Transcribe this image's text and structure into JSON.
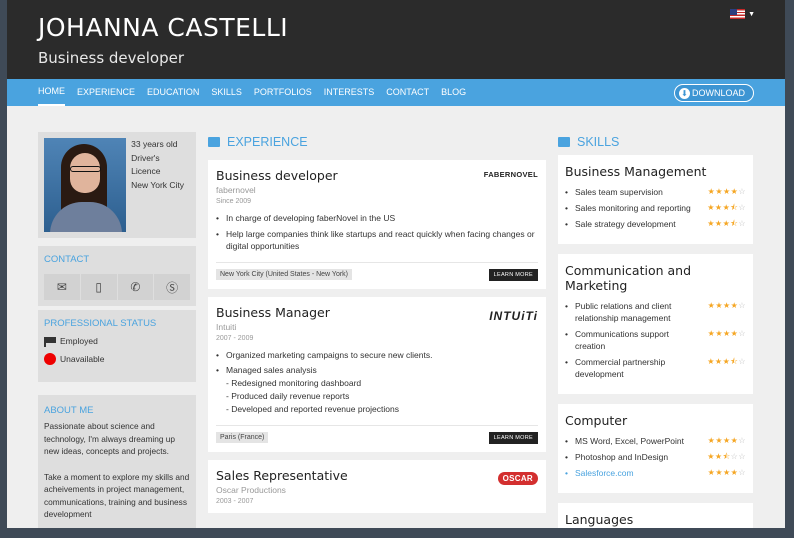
{
  "header": {
    "name": "JOHANNA CASTELLI",
    "role": "Business developer"
  },
  "nav": {
    "items": [
      "HOME",
      "EXPERIENCE",
      "EDUCATION",
      "SKILLS",
      "PORTFOLIOS",
      "INTERESTS",
      "CONTACT",
      "BLOG"
    ],
    "active": "HOME",
    "download_label": "DOWNLOAD"
  },
  "profile": {
    "age": "33 years old",
    "licence": "Driver's Licence",
    "city": "New York City"
  },
  "contact": {
    "title": "CONTACT",
    "icons": [
      "email-icon",
      "mobile-icon",
      "phone-icon",
      "skype-icon"
    ]
  },
  "status": {
    "title": "PROFESSIONAL STATUS",
    "employment": "Employed",
    "availability": "Unavailable"
  },
  "about": {
    "title": "ABOUT ME",
    "p1": "Passionate about science and technology, I'm always dreaming up new ideas, concepts and projects.",
    "p2": "Take a moment to explore my skills and acheivements in project management, communications, training and business development"
  },
  "experience": {
    "title": "EXPERIENCE",
    "learn_more": "LEARN MORE",
    "jobs": [
      {
        "title": "Business developer",
        "company": "fabernovel",
        "dates": "Since 2009",
        "logo": "FABERNOVEL",
        "bullets": [
          "In charge of developing faberNovel in the US",
          "Help large companies think like startups and react quickly when facing changes or digital opportunities"
        ],
        "location": "New York City (United States - New York)"
      },
      {
        "title": "Business Manager",
        "company": "Intuiti",
        "dates": "2007 - 2009",
        "logo": "INTUiTi",
        "bullet1": "Organized marketing campaigns to secure new clients.",
        "bullet2": "Managed sales analysis",
        "sub": [
          "- Redesigned monitoring dashboard",
          "- Produced daily revenue reports",
          "- Developed and reported revenue projections"
        ],
        "location": "Paris (France)"
      },
      {
        "title": "Sales Representative",
        "company": "Oscar Productions",
        "dates": "2003 - 2007",
        "logo": "OSCAR"
      }
    ]
  },
  "skills": {
    "title": "SKILLS",
    "groups": [
      {
        "title": "Business Management",
        "items": [
          {
            "name": "Sales team supervision",
            "rating": 4
          },
          {
            "name": "Sales monitoring and reporting",
            "rating": 3.5
          },
          {
            "name": "Sale strategy development",
            "rating": 3.5
          }
        ]
      },
      {
        "title": "Communication and Marketing",
        "items": [
          {
            "name": "Public relations and client relationship management",
            "rating": 4
          },
          {
            "name": "Communications support creation",
            "rating": 4
          },
          {
            "name": "Commercial partnership development",
            "rating": 3.5
          }
        ]
      },
      {
        "title": "Computer",
        "items": [
          {
            "name": "MS Word, Excel, PowerPoint",
            "rating": 4
          },
          {
            "name": "Photoshop and InDesign",
            "rating": 2.5
          },
          {
            "name": "Salesforce.com",
            "rating": 4,
            "link": true
          }
        ]
      },
      {
        "title": "Languages",
        "items": []
      }
    ]
  },
  "colors": {
    "accent": "#4aa3df",
    "header_bg": "#2b2b2b",
    "star": "#f5a623",
    "unavailable": "#ee0000"
  }
}
